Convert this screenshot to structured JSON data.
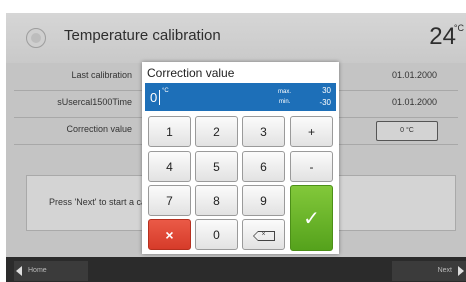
{
  "header": {
    "title": "Temperature calibration",
    "temperature": "24",
    "unit": "°C"
  },
  "rows": [
    {
      "label": "Last calibration",
      "value": "01.01.2000"
    },
    {
      "label": "sUsercal1500Time",
      "value": "01.01.2000"
    },
    {
      "label": "Correction value",
      "value": "0 °C"
    }
  ],
  "info": {
    "text": "Press 'Next' to start a calibration"
  },
  "footer": {
    "home_label": "Home",
    "next_label": "Next"
  },
  "dialog": {
    "title": "Correction value",
    "value": "0",
    "unit": "°C",
    "max_label": "max.",
    "min_label": "min.",
    "max_value": "30",
    "min_value": "-30",
    "keys": {
      "k1": "1",
      "k2": "2",
      "k3": "3",
      "plus": "+",
      "k4": "4",
      "k5": "5",
      "k6": "6",
      "minus": "-",
      "k7": "7",
      "k8": "8",
      "k9": "9",
      "k0": "0",
      "delete": "×",
      "ok": "✓",
      "backspace": "×"
    }
  }
}
